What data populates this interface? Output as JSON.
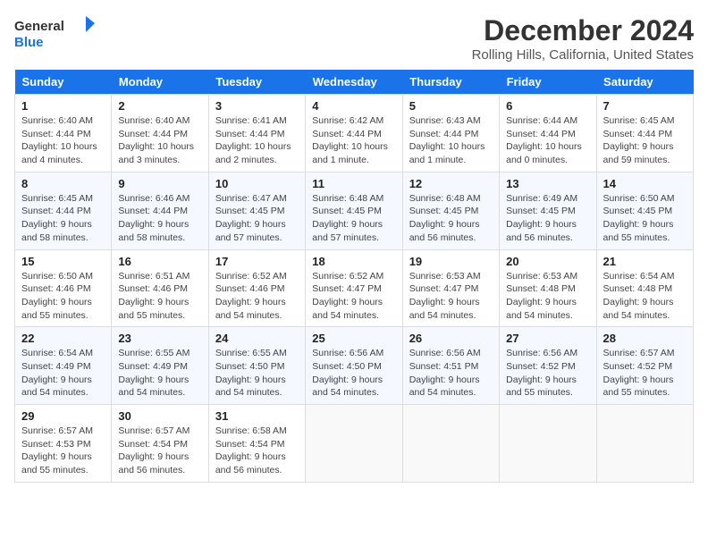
{
  "logo": {
    "text_general": "General",
    "text_blue": "Blue"
  },
  "title": "December 2024",
  "location": "Rolling Hills, California, United States",
  "days_of_week": [
    "Sunday",
    "Monday",
    "Tuesday",
    "Wednesday",
    "Thursday",
    "Friday",
    "Saturday"
  ],
  "weeks": [
    [
      {
        "day": "1",
        "sunrise": "6:40 AM",
        "sunset": "4:44 PM",
        "daylight": "10 hours and 4 minutes."
      },
      {
        "day": "2",
        "sunrise": "6:40 AM",
        "sunset": "4:44 PM",
        "daylight": "10 hours and 3 minutes."
      },
      {
        "day": "3",
        "sunrise": "6:41 AM",
        "sunset": "4:44 PM",
        "daylight": "10 hours and 2 minutes."
      },
      {
        "day": "4",
        "sunrise": "6:42 AM",
        "sunset": "4:44 PM",
        "daylight": "10 hours and 1 minute."
      },
      {
        "day": "5",
        "sunrise": "6:43 AM",
        "sunset": "4:44 PM",
        "daylight": "10 hours and 1 minute."
      },
      {
        "day": "6",
        "sunrise": "6:44 AM",
        "sunset": "4:44 PM",
        "daylight": "10 hours and 0 minutes."
      },
      {
        "day": "7",
        "sunrise": "6:45 AM",
        "sunset": "4:44 PM",
        "daylight": "9 hours and 59 minutes."
      }
    ],
    [
      {
        "day": "8",
        "sunrise": "6:45 AM",
        "sunset": "4:44 PM",
        "daylight": "9 hours and 58 minutes."
      },
      {
        "day": "9",
        "sunrise": "6:46 AM",
        "sunset": "4:44 PM",
        "daylight": "9 hours and 58 minutes."
      },
      {
        "day": "10",
        "sunrise": "6:47 AM",
        "sunset": "4:45 PM",
        "daylight": "9 hours and 57 minutes."
      },
      {
        "day": "11",
        "sunrise": "6:48 AM",
        "sunset": "4:45 PM",
        "daylight": "9 hours and 57 minutes."
      },
      {
        "day": "12",
        "sunrise": "6:48 AM",
        "sunset": "4:45 PM",
        "daylight": "9 hours and 56 minutes."
      },
      {
        "day": "13",
        "sunrise": "6:49 AM",
        "sunset": "4:45 PM",
        "daylight": "9 hours and 56 minutes."
      },
      {
        "day": "14",
        "sunrise": "6:50 AM",
        "sunset": "4:45 PM",
        "daylight": "9 hours and 55 minutes."
      }
    ],
    [
      {
        "day": "15",
        "sunrise": "6:50 AM",
        "sunset": "4:46 PM",
        "daylight": "9 hours and 55 minutes."
      },
      {
        "day": "16",
        "sunrise": "6:51 AM",
        "sunset": "4:46 PM",
        "daylight": "9 hours and 55 minutes."
      },
      {
        "day": "17",
        "sunrise": "6:52 AM",
        "sunset": "4:46 PM",
        "daylight": "9 hours and 54 minutes."
      },
      {
        "day": "18",
        "sunrise": "6:52 AM",
        "sunset": "4:47 PM",
        "daylight": "9 hours and 54 minutes."
      },
      {
        "day": "19",
        "sunrise": "6:53 AM",
        "sunset": "4:47 PM",
        "daylight": "9 hours and 54 minutes."
      },
      {
        "day": "20",
        "sunrise": "6:53 AM",
        "sunset": "4:48 PM",
        "daylight": "9 hours and 54 minutes."
      },
      {
        "day": "21",
        "sunrise": "6:54 AM",
        "sunset": "4:48 PM",
        "daylight": "9 hours and 54 minutes."
      }
    ],
    [
      {
        "day": "22",
        "sunrise": "6:54 AM",
        "sunset": "4:49 PM",
        "daylight": "9 hours and 54 minutes."
      },
      {
        "day": "23",
        "sunrise": "6:55 AM",
        "sunset": "4:49 PM",
        "daylight": "9 hours and 54 minutes."
      },
      {
        "day": "24",
        "sunrise": "6:55 AM",
        "sunset": "4:50 PM",
        "daylight": "9 hours and 54 minutes."
      },
      {
        "day": "25",
        "sunrise": "6:56 AM",
        "sunset": "4:50 PM",
        "daylight": "9 hours and 54 minutes."
      },
      {
        "day": "26",
        "sunrise": "6:56 AM",
        "sunset": "4:51 PM",
        "daylight": "9 hours and 54 minutes."
      },
      {
        "day": "27",
        "sunrise": "6:56 AM",
        "sunset": "4:52 PM",
        "daylight": "9 hours and 55 minutes."
      },
      {
        "day": "28",
        "sunrise": "6:57 AM",
        "sunset": "4:52 PM",
        "daylight": "9 hours and 55 minutes."
      }
    ],
    [
      {
        "day": "29",
        "sunrise": "6:57 AM",
        "sunset": "4:53 PM",
        "daylight": "9 hours and 55 minutes."
      },
      {
        "day": "30",
        "sunrise": "6:57 AM",
        "sunset": "4:54 PM",
        "daylight": "9 hours and 56 minutes."
      },
      {
        "day": "31",
        "sunrise": "6:58 AM",
        "sunset": "4:54 PM",
        "daylight": "9 hours and 56 minutes."
      },
      null,
      null,
      null,
      null
    ]
  ],
  "labels": {
    "sunrise": "Sunrise:",
    "sunset": "Sunset:",
    "daylight": "Daylight hours"
  }
}
